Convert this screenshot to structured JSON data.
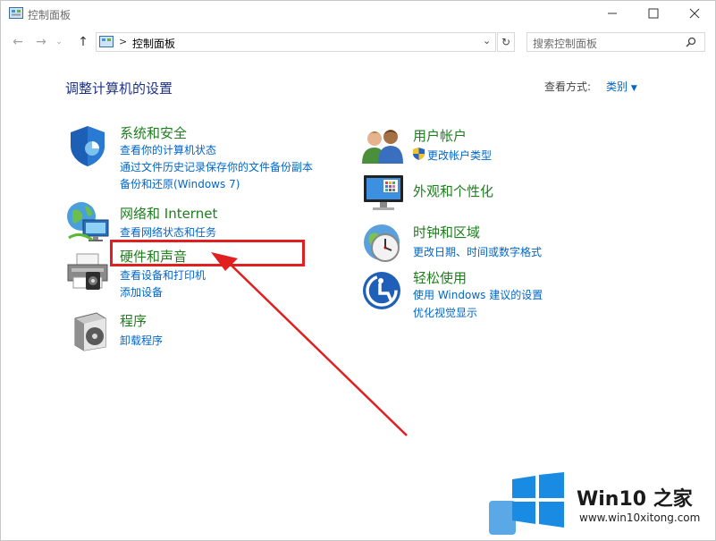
{
  "window": {
    "title": "控制面板",
    "minimize_icon": "minimize-icon",
    "maximize_icon": "maximize-icon",
    "close_icon": "close-icon"
  },
  "nav": {
    "breadcrumb_sep": ">",
    "address": "控制面板",
    "search_placeholder": "搜索控制面板"
  },
  "header": {
    "title": "调整计算机的设置",
    "view_by_label": "查看方式:",
    "view_by_value": "类别"
  },
  "left_categories": [
    {
      "title": "系统和安全",
      "icon": "shield-icon",
      "links": [
        "查看你的计算机状态",
        "通过文件历史记录保存你的文件备份副本",
        "备份和还原(Windows 7)"
      ]
    },
    {
      "title": "网络和 Internet",
      "icon": "network-icon",
      "links": [
        "查看网络状态和任务"
      ]
    },
    {
      "title": "硬件和声音",
      "icon": "printer-icon",
      "links": [
        "查看设备和打印机",
        "添加设备"
      ]
    },
    {
      "title": "程序",
      "icon": "programs-icon",
      "links": [
        "卸载程序"
      ]
    }
  ],
  "right_categories": [
    {
      "title": "用户帐户",
      "icon": "users-icon",
      "links": [
        "更改帐户类型"
      ]
    },
    {
      "title": "外观和个性化",
      "icon": "monitor-icon",
      "links": []
    },
    {
      "title": "时钟和区域",
      "icon": "clock-icon",
      "links": [
        "更改日期、时间或数字格式"
      ]
    },
    {
      "title": "轻松使用",
      "icon": "accessibility-icon",
      "links": [
        "使用 Windows 建议的设置",
        "优化视觉显示"
      ]
    }
  ],
  "watermark": {
    "brand": "Win10 之家",
    "url": "www.win10xitong.com"
  },
  "colors": {
    "accent": "#0066cc",
    "category_green": "#1e7e1e",
    "highlight_red": "#e02020"
  }
}
